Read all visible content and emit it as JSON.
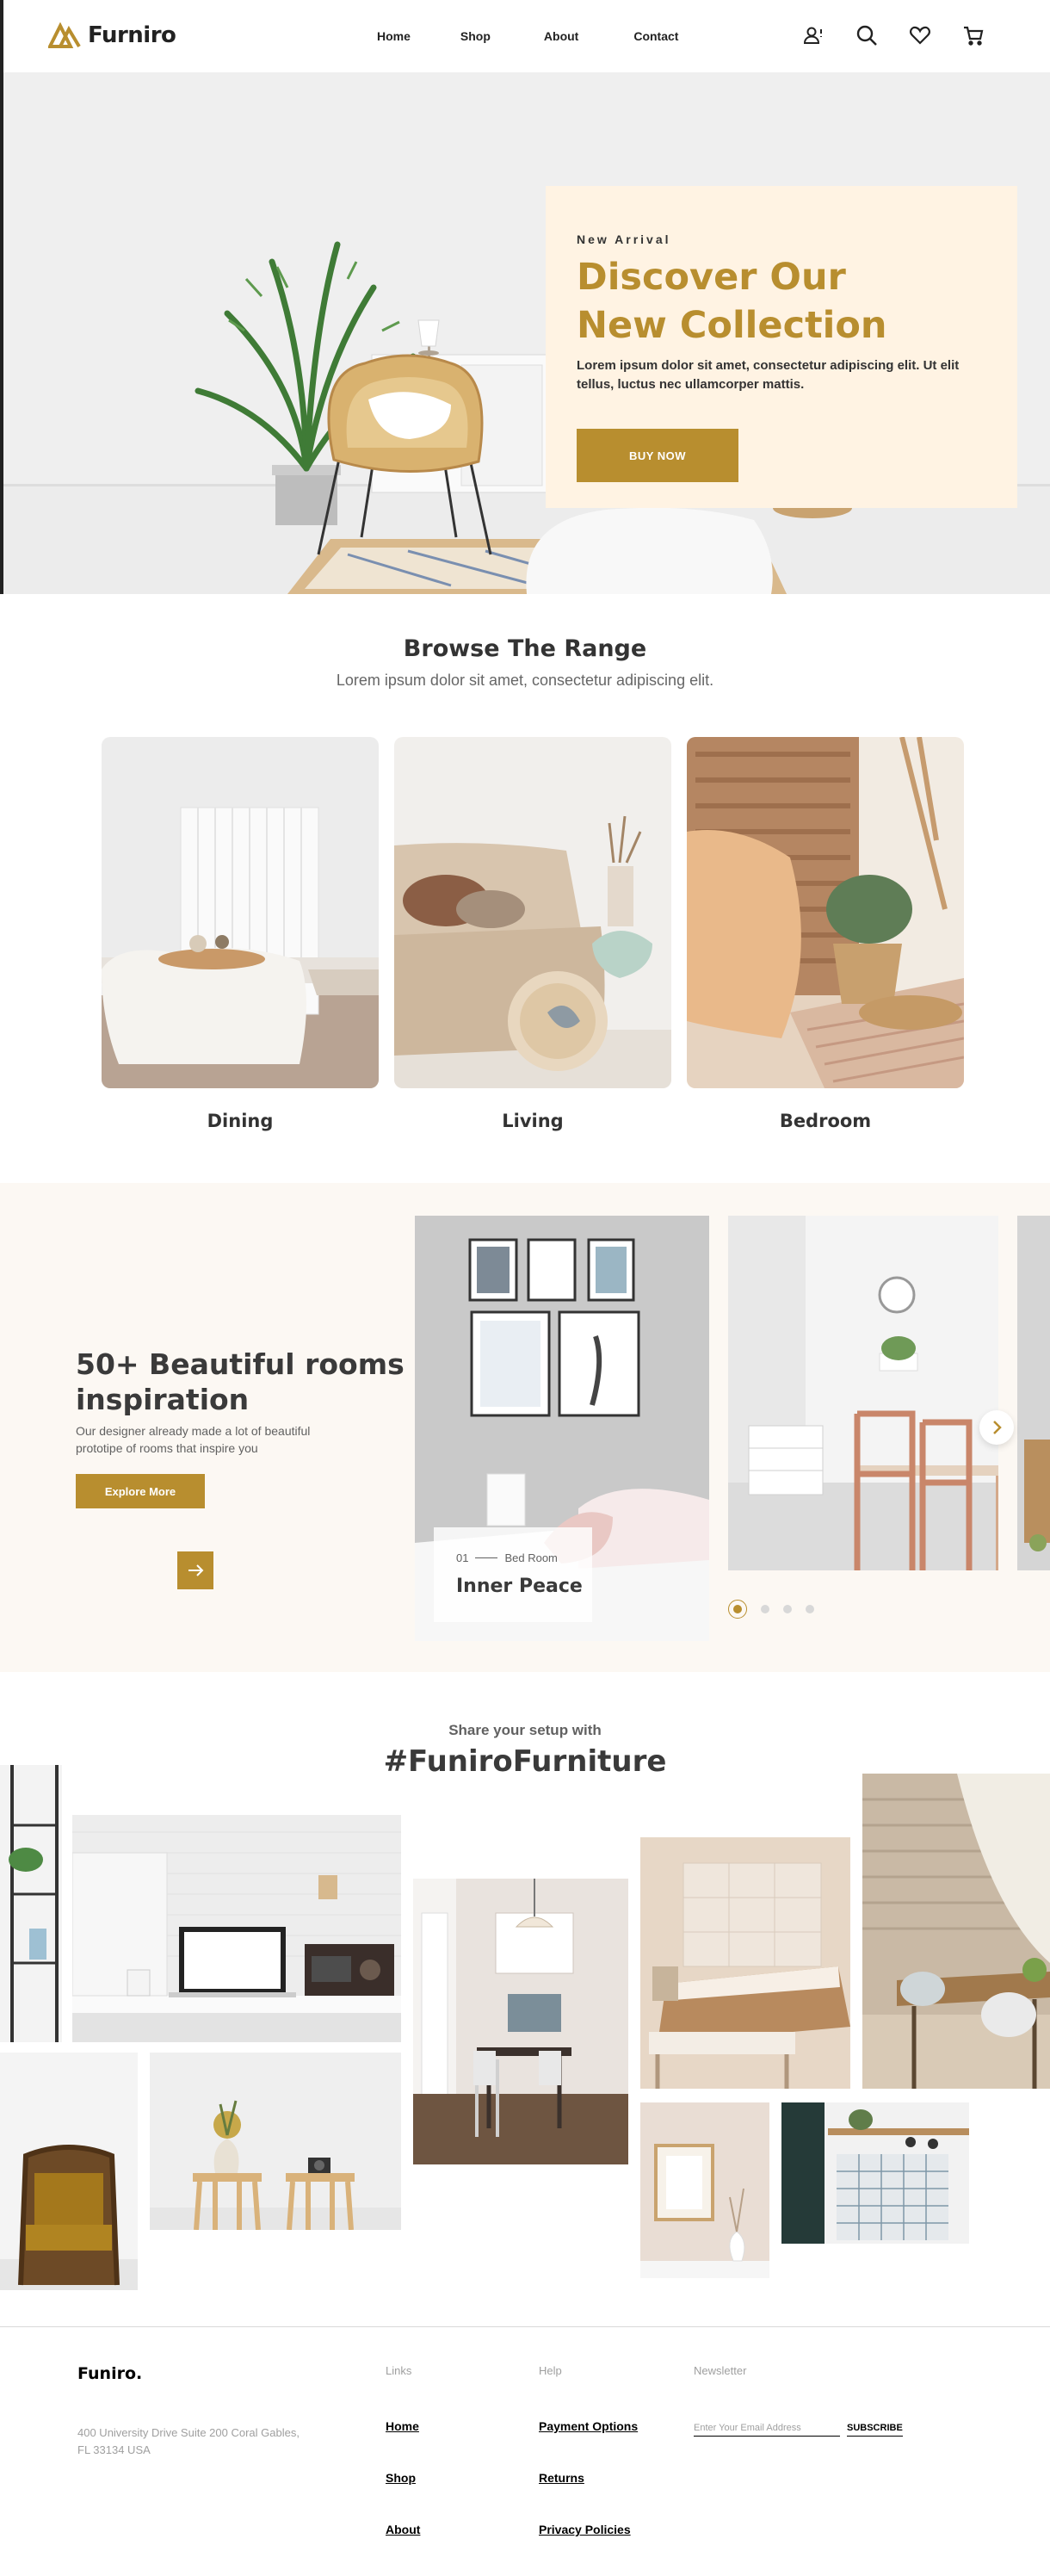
{
  "brand": {
    "name": "Furniro",
    "accent": "#b88e2f"
  },
  "nav": {
    "home": "Home",
    "shop": "Shop",
    "about": "About",
    "contact": "Contact"
  },
  "header_icons": [
    "account-alert-icon",
    "search-icon",
    "heart-icon",
    "cart-icon"
  ],
  "hero": {
    "kicker": "New Arrival",
    "title": "Discover Our New Collection",
    "description": "Lorem ipsum dolor sit amet, consectetur adipiscing elit. Ut elit tellus, luctus nec ullamcorper mattis.",
    "button": "BUY NOW"
  },
  "browse": {
    "title": "Browse The Range",
    "subtitle": "Lorem ipsum dolor sit amet, consectetur adipiscing elit.",
    "categories": [
      {
        "label": "Dining"
      },
      {
        "label": "Living"
      },
      {
        "label": "Bedroom"
      }
    ]
  },
  "inspiration": {
    "title": "50+ Beautiful rooms inspiration",
    "description": "Our designer already made a lot of beautiful prototipe of rooms that inspire you",
    "button": "Explore More",
    "slide": {
      "number": "01",
      "category": "Bed Room",
      "name": "Inner Peace"
    },
    "dots": {
      "count": 4,
      "active_index": 0
    }
  },
  "share": {
    "subtitle": "Share your setup with",
    "title": "#FuniroFurniture"
  },
  "footer": {
    "brand": "Funiro.",
    "address": "400 University Drive Suite 200 Coral Gables, FL 33134 USA",
    "links": {
      "heading": "Links",
      "items": [
        "Home",
        "Shop",
        "About"
      ]
    },
    "help": {
      "heading": "Help",
      "items": [
        "Payment Options",
        "Returns",
        "Privacy Policies"
      ]
    },
    "newsletter": {
      "heading": "Newsletter",
      "placeholder": "Enter Your Email Address",
      "button": "SUBSCRIBE"
    }
  }
}
